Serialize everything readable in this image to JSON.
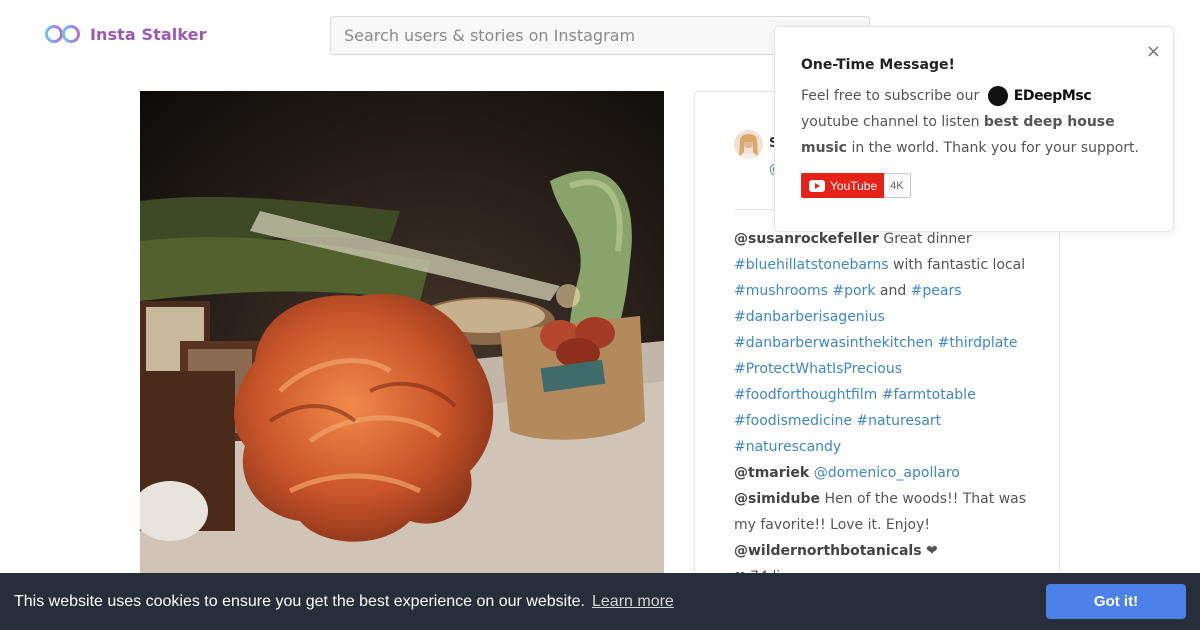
{
  "header": {
    "logo_text": "Insta Stalker",
    "search_placeholder": "Search users & stories on Instagram"
  },
  "post": {
    "author_name": "S",
    "author_handle": "@",
    "comments": [
      {
        "user": "@susanrockefeller",
        "parts": [
          {
            "t": "text",
            "v": " Great dinner "
          },
          {
            "t": "link",
            "v": "#bluehillatstonebarns"
          },
          {
            "t": "text",
            "v": " with fantastic local "
          },
          {
            "t": "link",
            "v": "#mushrooms"
          },
          {
            "t": "text",
            "v": " "
          },
          {
            "t": "link",
            "v": "#pork"
          },
          {
            "t": "text",
            "v": " and "
          },
          {
            "t": "link",
            "v": "#pears"
          },
          {
            "t": "text",
            "v": " "
          },
          {
            "t": "link",
            "v": "#danbarberisagenius"
          },
          {
            "t": "text",
            "v": " "
          },
          {
            "t": "link",
            "v": "#danbarberwasinthekitchen"
          },
          {
            "t": "text",
            "v": " "
          },
          {
            "t": "link",
            "v": "#thirdplate"
          },
          {
            "t": "text",
            "v": " "
          },
          {
            "t": "link",
            "v": "#ProtectWhatIsPrecious"
          },
          {
            "t": "text",
            "v": " "
          },
          {
            "t": "link",
            "v": "#foodforthoughtfilm"
          },
          {
            "t": "text",
            "v": " "
          },
          {
            "t": "link",
            "v": "#farmtotable"
          },
          {
            "t": "text",
            "v": " "
          },
          {
            "t": "link",
            "v": "#foodismedicine"
          },
          {
            "t": "text",
            "v": " "
          },
          {
            "t": "link",
            "v": "#naturesart"
          },
          {
            "t": "text",
            "v": " "
          },
          {
            "t": "link",
            "v": "#naturescandy"
          }
        ]
      },
      {
        "user": "@tmariek",
        "parts": [
          {
            "t": "text",
            "v": " "
          },
          {
            "t": "link",
            "v": "@domenico_apollaro"
          }
        ]
      },
      {
        "user": "@simidube",
        "parts": [
          {
            "t": "text",
            "v": " Hen of the woods!! That was my favorite!! Love it. Enjoy!"
          }
        ]
      },
      {
        "user": "@wildernorthbotanicals",
        "parts": [
          {
            "t": "text",
            "v": " ❤"
          }
        ]
      }
    ],
    "likes_text": "❤ 74 li"
  },
  "popup": {
    "close_glyph": "×",
    "title": "One-Time Message!",
    "body_prefix": "Feel free to subscribe our",
    "brand_name": "EDeepMsc",
    "body_mid": "youtube channel to listen",
    "body_bold": "best deep house music",
    "body_suffix": "in the world. Thank you for your support.",
    "youtube_label": "YouTube",
    "youtube_count": "4K"
  },
  "cookie": {
    "message": "This website uses cookies to ensure you get the best experience on our website.",
    "learn_more": "Learn more",
    "accept": "Got it!"
  },
  "colors": {
    "brand_purple": "#9b59b6",
    "link_blue": "#3f86c6",
    "cookie_bg": "#252e39",
    "cookie_button": "#4b81e8",
    "youtube_red": "#e62117"
  },
  "icons": [
    "infinity-logo-icon",
    "close-icon",
    "youtube-play-icon",
    "heart-icon"
  ]
}
